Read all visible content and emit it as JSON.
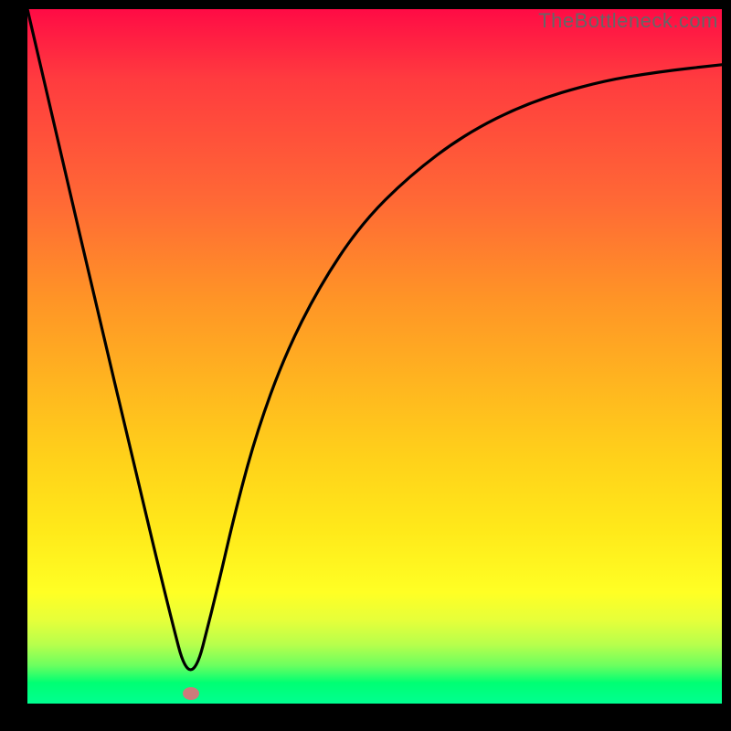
{
  "attribution": "TheBottleneck.com",
  "gradient_colors": [
    "#ff0b45",
    "#ff3b3f",
    "#ff6a35",
    "#ff9526",
    "#ffb81f",
    "#ffd21a",
    "#ffe91a",
    "#ffff24",
    "#e6ff3a",
    "#b7ff4c",
    "#6cff5f",
    "#00ff73",
    "#00ff90"
  ],
  "marker": {
    "x_frac": 0.235,
    "y_frac": 0.985,
    "color": "#cc7b7b"
  },
  "chart_data": {
    "type": "line",
    "title": "",
    "xlabel": "",
    "ylabel": "",
    "xlim": [
      0,
      1
    ],
    "ylim": [
      0,
      100
    ],
    "series": [
      {
        "name": "bottleneck-curve",
        "x": [
          0.0,
          0.05,
          0.1,
          0.15,
          0.2,
          0.235,
          0.27,
          0.3,
          0.33,
          0.37,
          0.42,
          0.48,
          0.55,
          0.63,
          0.72,
          0.82,
          0.91,
          1.0
        ],
        "y": [
          100.0,
          78.5,
          57.0,
          36.0,
          15.0,
          1.5,
          15.0,
          28.0,
          39.0,
          50.0,
          60.0,
          69.0,
          76.0,
          82.0,
          86.5,
          89.5,
          91.0,
          92.0
        ]
      }
    ],
    "marker_point": {
      "x": 0.235,
      "y": 1.5
    }
  }
}
